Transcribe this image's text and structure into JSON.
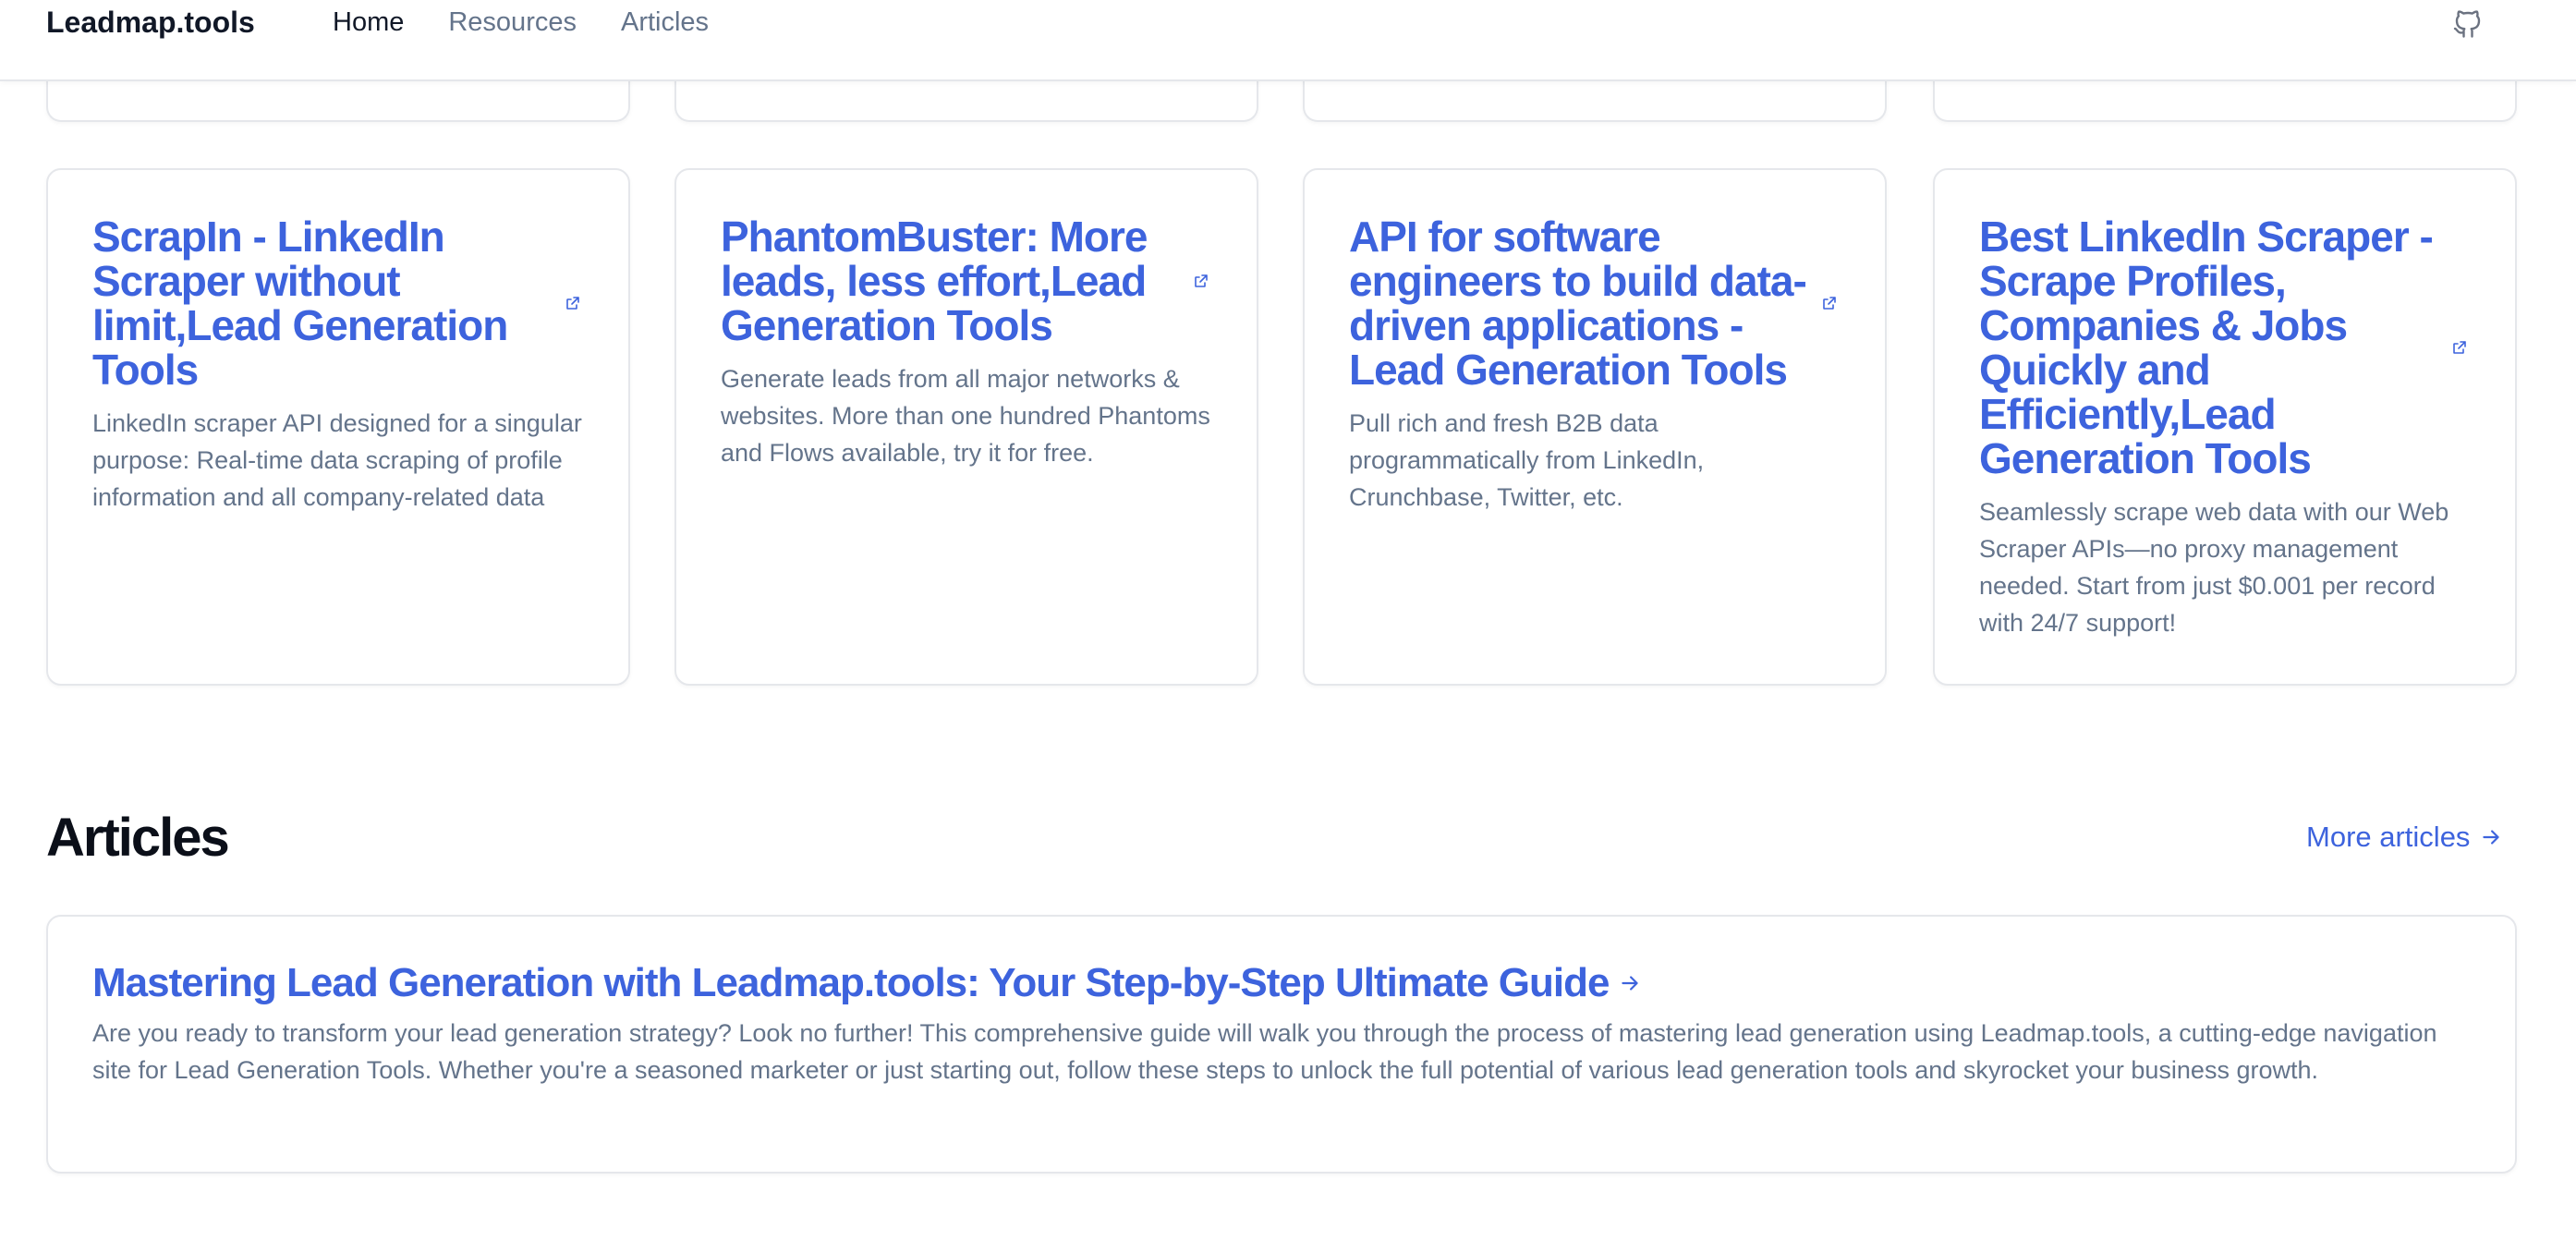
{
  "header": {
    "brand": "Leadmap.tools",
    "nav": [
      {
        "label": "Home",
        "active": true
      },
      {
        "label": "Resources",
        "active": false
      },
      {
        "label": "Articles",
        "active": false
      }
    ],
    "github_icon": "github-icon"
  },
  "tools": [
    {
      "title": "ScrapIn - LinkedIn Scraper without limit,Lead Generation Tools",
      "description": "LinkedIn scraper API designed for a singular purpose: Real-time data scraping of profile information and all company-related data"
    },
    {
      "title": "PhantomBuster: More leads, less effort,Lead Generation Tools",
      "description": "Generate leads from all major networks & websites. More than one hundred Phantoms and Flows available, try it for free."
    },
    {
      "title": "API for software engineers to build data-driven applications - Lead Generation Tools",
      "description": "Pull rich and fresh B2B data programmatically from LinkedIn, Crunchbase, Twitter, etc."
    },
    {
      "title": "Best LinkedIn Scraper - Scrape Profiles, Companies & Jobs Quickly and Efficiently,Lead Generation Tools",
      "description": "Seamlessly scrape web data with our Web Scraper APIs—no proxy management needed. Start from just $0.001 per record with 24/7 support!"
    }
  ],
  "articles": {
    "heading": "Articles",
    "more_label": "More articles",
    "items": [
      {
        "title": "Mastering Lead Generation with Leadmap.tools: Your Step-by-Step Ultimate Guide",
        "description": "Are you ready to transform your lead generation strategy? Look no further! This comprehensive guide will walk you through the process of mastering lead generation using Leadmap.tools, a cutting-edge navigation site for Lead Generation Tools. Whether you're a seasoned marketer or just starting out, follow these steps to unlock the full potential of various lead generation tools and skyrocket your business growth."
      }
    ]
  },
  "colors": {
    "accent": "#3d63dd",
    "muted_text": "#64748b",
    "border": "#e5e7eb"
  }
}
